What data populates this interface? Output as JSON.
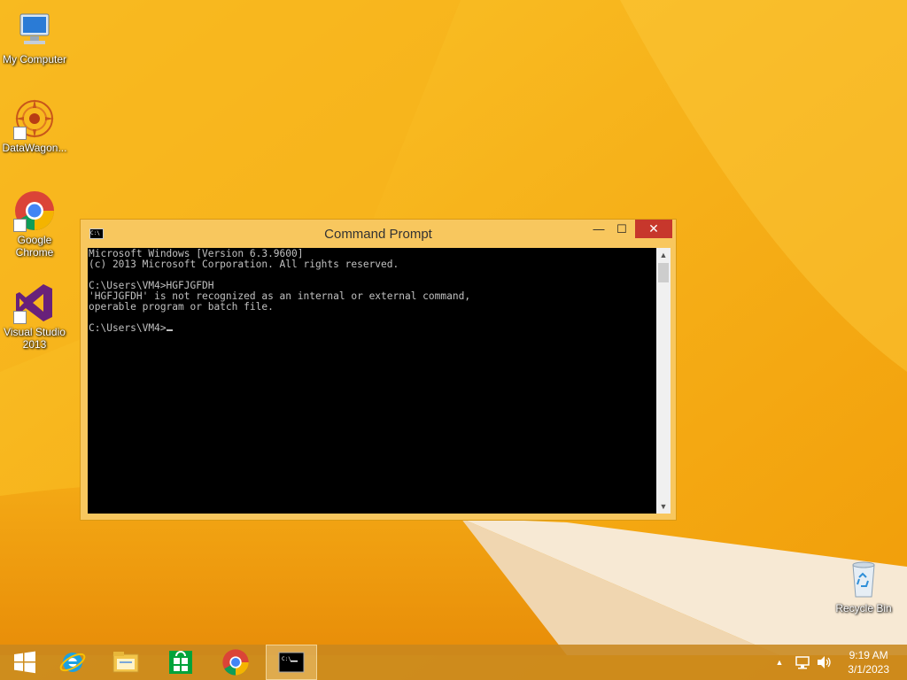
{
  "desktop": {
    "icons": [
      {
        "label": "My Computer"
      },
      {
        "label": "DataWagon..."
      },
      {
        "label": "Google Chrome"
      },
      {
        "label": "Visual Studio 2013"
      },
      {
        "label": "Recycle Bin"
      }
    ]
  },
  "window": {
    "title": "Command Prompt",
    "icon_text": "C:\\",
    "minimize_glyph": "—",
    "maximize_glyph": "☐",
    "close_glyph": "✕",
    "console_lines": [
      "Microsoft Windows [Version 6.3.9600]",
      "(c) 2013 Microsoft Corporation. All rights reserved.",
      "",
      "C:\\Users\\VM4>HGFJGFDH",
      "'HGFJGFDH' is not recognized as an internal or external command,",
      "operable program or batch file.",
      "",
      "C:\\Users\\VM4>"
    ]
  },
  "taskbar": {
    "items": [
      "start-icon",
      "internet-explorer-icon",
      "file-explorer-icon",
      "store-icon",
      "chrome-icon",
      "command-prompt-icon"
    ],
    "active": "command-prompt-icon",
    "clock": {
      "time": "9:19 AM",
      "date": "3/1/2023"
    }
  },
  "colors": {
    "wallpaper": "#f6b20e",
    "window_frame": "#f8c75e",
    "close_button": "#c7372c",
    "console_bg": "#000000",
    "console_fg": "#c0c0c0"
  }
}
